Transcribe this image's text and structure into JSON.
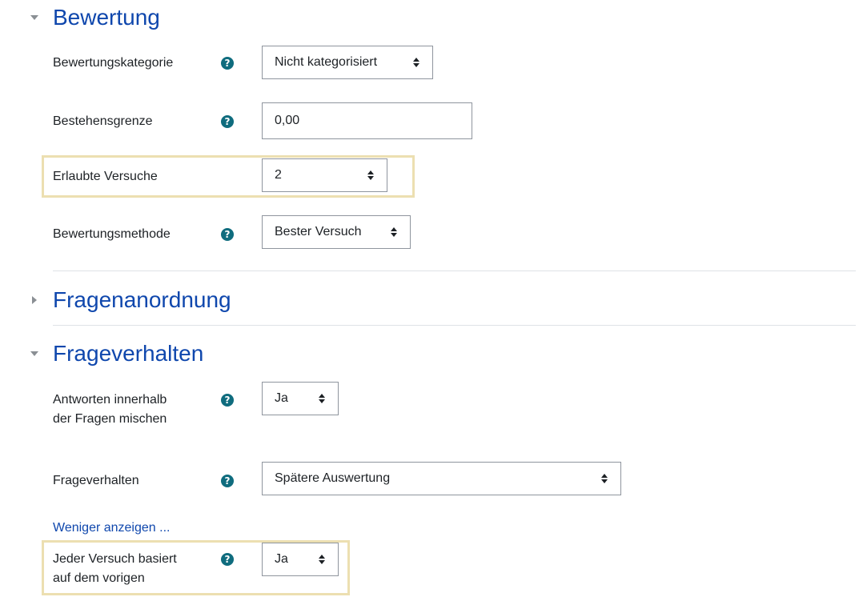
{
  "sections": {
    "bewertung": {
      "title": "Bewertung"
    },
    "fragenanordnung": {
      "title": "Fragenanordnung"
    },
    "frageverhalten": {
      "title": "Frageverhalten"
    }
  },
  "bewertung": {
    "kategorie": {
      "label": "Bewertungskategorie",
      "value": "Nicht kategorisiert"
    },
    "bestehensgrenze": {
      "label": "Bestehensgrenze",
      "value": "0,00"
    },
    "versuche": {
      "label": "Erlaubte Versuche",
      "value": "2"
    },
    "methode": {
      "label": "Bewertungsmethode",
      "value": "Bester Versuch"
    }
  },
  "frageverhalten": {
    "mischen": {
      "label_line1": "Antworten innerhalb",
      "label_line2": "der Fragen mischen",
      "value": "Ja"
    },
    "verhalten": {
      "label": "Frageverhalten",
      "value": "Spätere Auswertung"
    },
    "weniger_link": "Weniger anzeigen ...",
    "basiert": {
      "label_line1": "Jeder Versuch basiert",
      "label_line2": "auf dem vorigen",
      "value": "Ja"
    }
  },
  "help_icon_glyph": "?",
  "colors": {
    "link": "#0f47ad",
    "help": "#0f6c7e",
    "highlight": "#ecdfb1"
  }
}
